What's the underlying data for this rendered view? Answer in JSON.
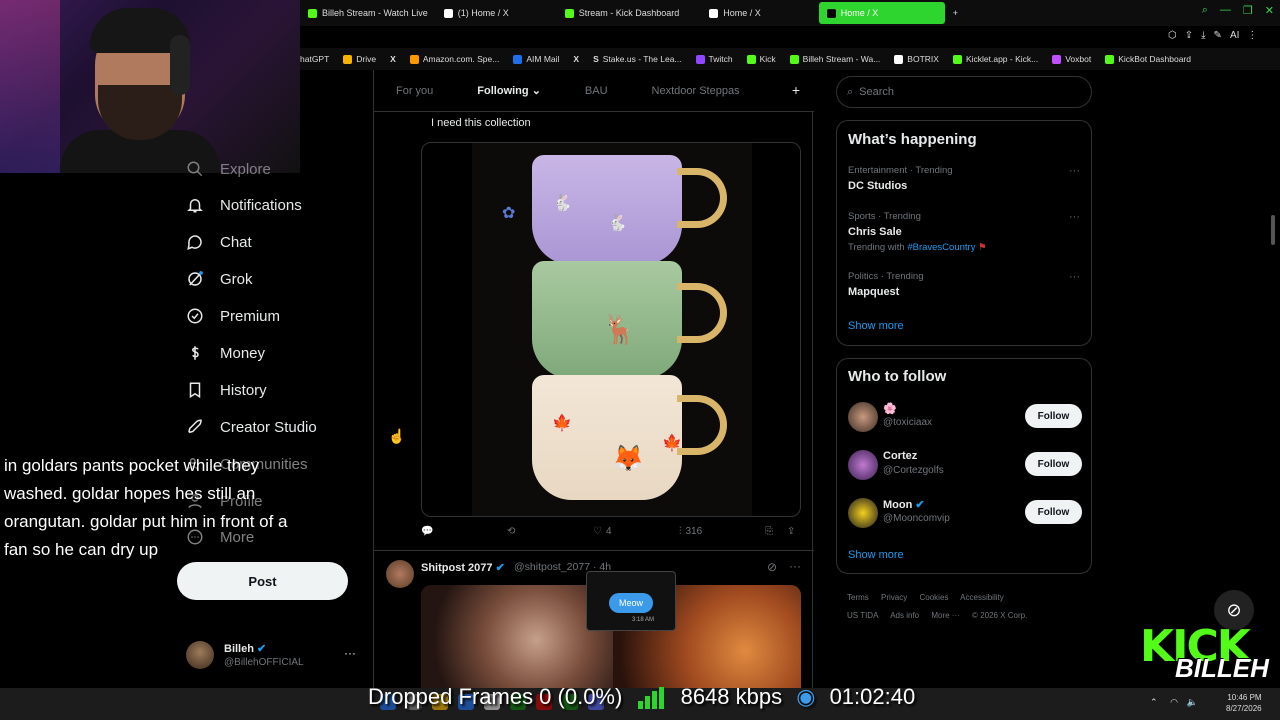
{
  "tabs": [
    {
      "label": "Billeh Stream - Watch Live",
      "color": "#53fc18",
      "active": false
    },
    {
      "label": "(1) Home / X",
      "color": "#ffffff",
      "active": false
    },
    {
      "label": "Stream - Kick Dashboard",
      "color": "#53fc18",
      "active": false
    },
    {
      "label": "Home / X",
      "color": "#ffffff",
      "active": false
    },
    {
      "label": "Home / X",
      "color": "#ffffff",
      "active": true
    }
  ],
  "bookmarks": [
    {
      "label": "hatGPT",
      "color": "#10a37f"
    },
    {
      "label": "Drive",
      "color": "#f4b400"
    },
    {
      "label": "",
      "color": "#ffffff"
    },
    {
      "label": "Amazon.com. Spe...",
      "color": "#ff9900"
    },
    {
      "label": "AIM Mail",
      "color": "#1f6feb"
    },
    {
      "label": "",
      "color": "#ffffff"
    },
    {
      "label": "Stake.us - The Lea...",
      "color": "#ffffff"
    },
    {
      "label": "Twitch",
      "color": "#9146ff"
    },
    {
      "label": "Kick",
      "color": "#53fc18"
    },
    {
      "label": "Billeh Stream - Wa...",
      "color": "#53fc18"
    },
    {
      "label": "BOTRIX",
      "color": "#ffffff"
    },
    {
      "label": "Kicklet.app - Kick...",
      "color": "#53fc18"
    },
    {
      "label": "Voxbot",
      "color": "#c04fff"
    },
    {
      "label": "KickBot Dashboard",
      "color": "#53fc18"
    }
  ],
  "nav": {
    "explore": "Explore",
    "notifications": "Notifications",
    "chat": "Chat",
    "grok": "Grok",
    "premium": "Premium",
    "money": "Money",
    "history": "History",
    "creator_studio": "Creator Studio",
    "communities": "Communities",
    "profile": "Profile",
    "more": "More",
    "post": "Post"
  },
  "account": {
    "name": "Billeh",
    "handle": "@BillehOFFICIAL",
    "more": "···"
  },
  "captions": "in goldars pants pocket while they washed. goldar hopes hes still an orangutan. goldar put him in front of a fan so he can dry up",
  "feed_tabs": [
    "For you",
    "Following",
    "BAU",
    "Nextdoor Steppas"
  ],
  "feed_add": "+",
  "tweet1": {
    "text": "I need this collection",
    "likes": "4",
    "views": "316"
  },
  "tweet2": {
    "name": "Shitpost 2077",
    "meta": "@shitpost_2077 · 4h",
    "bubble": "Meow",
    "bubble_time": "3:18 AM"
  },
  "search": {
    "placeholder": "Search"
  },
  "trends": {
    "title": "What’s happening",
    "items": [
      {
        "meta": "Entertainment · Trending",
        "title": "DC Studios",
        "with": ""
      },
      {
        "meta": "Sports · Trending",
        "title": "Chris Sale",
        "with_prefix": "Trending with",
        "with": "#BravesCountry"
      },
      {
        "meta": "Politics · Trending",
        "title": "Mapquest",
        "with": ""
      }
    ],
    "show_more": "Show more"
  },
  "who_to_follow": {
    "title": "Who to follow",
    "items": [
      {
        "name": "🌸",
        "handle": "@toxiciaax",
        "button": "Follow"
      },
      {
        "name": "Cortez",
        "handle": "@Cortezgolfs",
        "button": "Follow"
      },
      {
        "name": "Moon",
        "handle": "@Mooncomvip",
        "button": "Follow"
      }
    ],
    "show_more": "Show more"
  },
  "footer": [
    "Terms",
    "Privacy",
    "Cookies",
    "Accessibility",
    "US TIDA",
    "Ads info",
    "More ···",
    "© 2026 X Corp."
  ],
  "obs": {
    "dropped": "Dropped Frames 0 (0.0%)",
    "bitrate": "8648 kbps",
    "time": "01:02:40"
  },
  "clock": {
    "time": "10:46 PM",
    "date": "8/27/2026"
  },
  "kick": {
    "logo": "KICK",
    "name": "BILLEH"
  },
  "colors": {
    "accent": "#1d9bf0",
    "kick_green": "#53fc18",
    "bg": "#000000"
  }
}
